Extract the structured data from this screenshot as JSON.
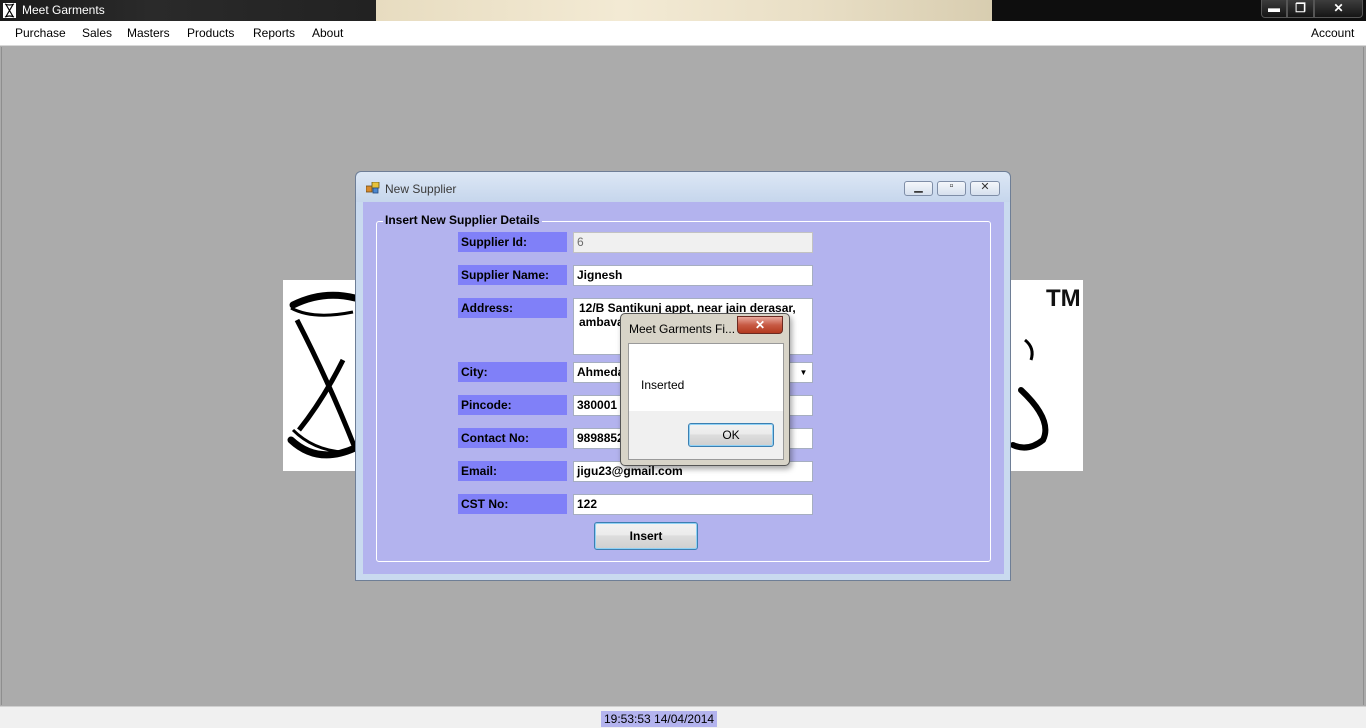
{
  "app": {
    "title": "Meet Garments",
    "window_buttons": {
      "minimize": "▬",
      "maximize": "❐",
      "close": "✕"
    }
  },
  "menubar": {
    "items": [
      "Purchase",
      "Sales",
      "Masters",
      "Products",
      "Reports",
      "About"
    ],
    "account": "Account"
  },
  "logo": {
    "tm": "TM"
  },
  "form": {
    "title": "New Supplier",
    "group_title": "Insert New Supplier Details",
    "fields": {
      "supplier_id": {
        "label": "Supplier Id:",
        "value": "6"
      },
      "supplier_name": {
        "label": "Supplier Name:",
        "value": "Jignesh"
      },
      "address": {
        "label": "Address:",
        "value": "12/B Santikunj appt, near jain derasar, ambavadi"
      },
      "city": {
        "label": "City:",
        "value": "Ahmedabad"
      },
      "pincode": {
        "label": "Pincode:",
        "value": "380001"
      },
      "contact_no": {
        "label": "Contact No:",
        "value": "9898852541"
      },
      "email": {
        "label": "Email:",
        "value": "jigu23@gmail.com"
      },
      "cst_no": {
        "label": "CST No:",
        "value": "122"
      }
    },
    "insert_label": "Insert"
  },
  "messagebox": {
    "title": "Meet Garments Fi...",
    "close": "✕",
    "message": "Inserted",
    "ok_label": "OK"
  },
  "statusbar": {
    "clock": "19:53:53 14/04/2014"
  },
  "colors": {
    "form_client": "#b3b3ee",
    "label_bg": "#8080f8",
    "mdi_background": "#ababab"
  }
}
